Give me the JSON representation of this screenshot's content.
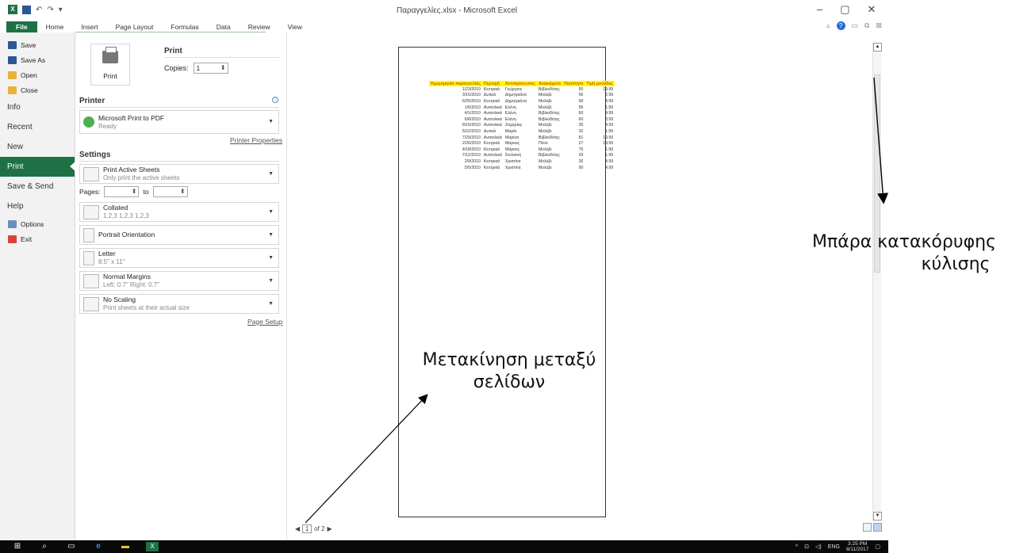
{
  "window": {
    "title": "Παραγγελίες.xlsx - Microsoft Excel",
    "minimize": "–",
    "restore": "▢",
    "close": "✕"
  },
  "ribbon": {
    "tabs": [
      "File",
      "Home",
      "Insert",
      "Page Layout",
      "Formulas",
      "Data",
      "Review",
      "View"
    ]
  },
  "backstage": {
    "commands": [
      {
        "label": "Save",
        "icon": "save-icon",
        "color": "#2b5797"
      },
      {
        "label": "Save As",
        "icon": "save-as-icon",
        "color": "#2b5797"
      },
      {
        "label": "Open",
        "icon": "open-folder-icon",
        "color": "#e8b23b"
      },
      {
        "label": "Close",
        "icon": "close-folder-icon",
        "color": "#e8b23b"
      }
    ],
    "sections": [
      "Info",
      "Recent",
      "New",
      "Print",
      "Save & Send",
      "Help"
    ],
    "active_section": "Print",
    "bottom": [
      {
        "label": "Options",
        "icon": "options-icon",
        "color": "#6a8fbf"
      },
      {
        "label": "Exit",
        "icon": "exit-icon",
        "color": "#d9443a"
      }
    ]
  },
  "print_panel": {
    "button_label": "Print",
    "title": "Print",
    "copies_label": "Copies:",
    "copies_value": "1",
    "printer_header": "Printer",
    "printer_name": "Microsoft Print to PDF",
    "printer_status": "Ready",
    "printer_properties": "Printer Properties",
    "settings_header": "Settings",
    "scope_title": "Print Active Sheets",
    "scope_sub": "Only print the active sheets",
    "pages_label": "Pages:",
    "pages_to": "to",
    "collated_title": "Collated",
    "collated_sub": "1,2,3   1,2,3   1,2,3",
    "orientation": "Portrait Orientation",
    "paper_title": "Letter",
    "paper_sub": "8.5\" x 11\"",
    "margins_title": "Normal Margins",
    "margins_sub": "Left:  0.7\"    Right:  0.7\"",
    "scaling_title": "No Scaling",
    "scaling_sub": "Print sheets at their actual size",
    "page_setup": "Page Setup"
  },
  "preview": {
    "headers": [
      "Ημερομηνία παραγγελίας",
      "Περιοχή",
      "Αντιπρόσωπος",
      "Ανακείμενο",
      "Ποσότητα",
      "Τιμή μονάδας"
    ],
    "rows": [
      [
        "1/23/2010",
        "Κεντρικά",
        "Γεώργιος",
        "Βιβλιοδέτης",
        "50",
        "19.99"
      ],
      [
        "3/15/2010",
        "Δυτικά",
        "Δημητριάνα",
        "Μολύβι",
        "56",
        "2.99"
      ],
      [
        "6/25/2010",
        "Κεντρικά",
        "Δημητριάνα",
        "Μολύβι",
        "90",
        "4.99"
      ],
      [
        "1/6/2010",
        "Ανατολικά",
        "Ελένη",
        "Μολύβι",
        "95",
        "1.99"
      ],
      [
        "4/1/2010",
        "Ανατολικά",
        "Ελένη",
        "Βιβλιοδέτης",
        "60",
        "4.99"
      ],
      [
        "6/8/2010",
        "Ανατολικά",
        "Ελένη",
        "Βιβλιοδέτης",
        "60",
        "8.99"
      ],
      [
        "8/15/2010",
        "Ανατολικά",
        "Ζαχαρίας",
        "Μολύβι",
        "35",
        "4.99"
      ],
      [
        "5/22/2010",
        "Δυτικά",
        "Μαρία",
        "Μολύβι",
        "32",
        "1.99"
      ],
      [
        "7/29/2010",
        "Ανατολικά",
        "Μαρίνα",
        "Βιβλιοδέτης",
        "81",
        "19.99"
      ],
      [
        "2/26/2010",
        "Κεντρικά",
        "Μαρκος",
        "Πένα",
        "27",
        "19.99"
      ],
      [
        "4/18/2010",
        "Κεντρικά",
        "Μάρκος",
        "Μολύβι",
        "75",
        "1.99"
      ],
      [
        "7/12/2010",
        "Ανατολικά",
        "Στυλιανή",
        "Βιβλιοδέτης",
        "29",
        "1.99"
      ],
      [
        "2/9/2010",
        "Κεντρικά",
        "Χριστίνα",
        "Μολύβι",
        "36",
        "4.99"
      ],
      [
        "5/5/2010",
        "Κεντρικά",
        "Χριστίνα",
        "Μολύβι",
        "90",
        "4.99"
      ]
    ],
    "page_current": "1",
    "page_of": "of 2",
    "header_fill": "#ffff00",
    "header_text_color": "#c55a11"
  },
  "annotations": {
    "scrollbar_line1": "Μπάρα κατακόρυφης",
    "scrollbar_line2": "κύλισης",
    "pagenav_line1": "Μετακίνηση μεταξύ",
    "pagenav_line2": "σελίδων"
  },
  "taskbar": {
    "language": "ENG",
    "time": "3:25 PM",
    "date": "8/11/2017"
  },
  "colors": {
    "accent": "#1e7145"
  }
}
